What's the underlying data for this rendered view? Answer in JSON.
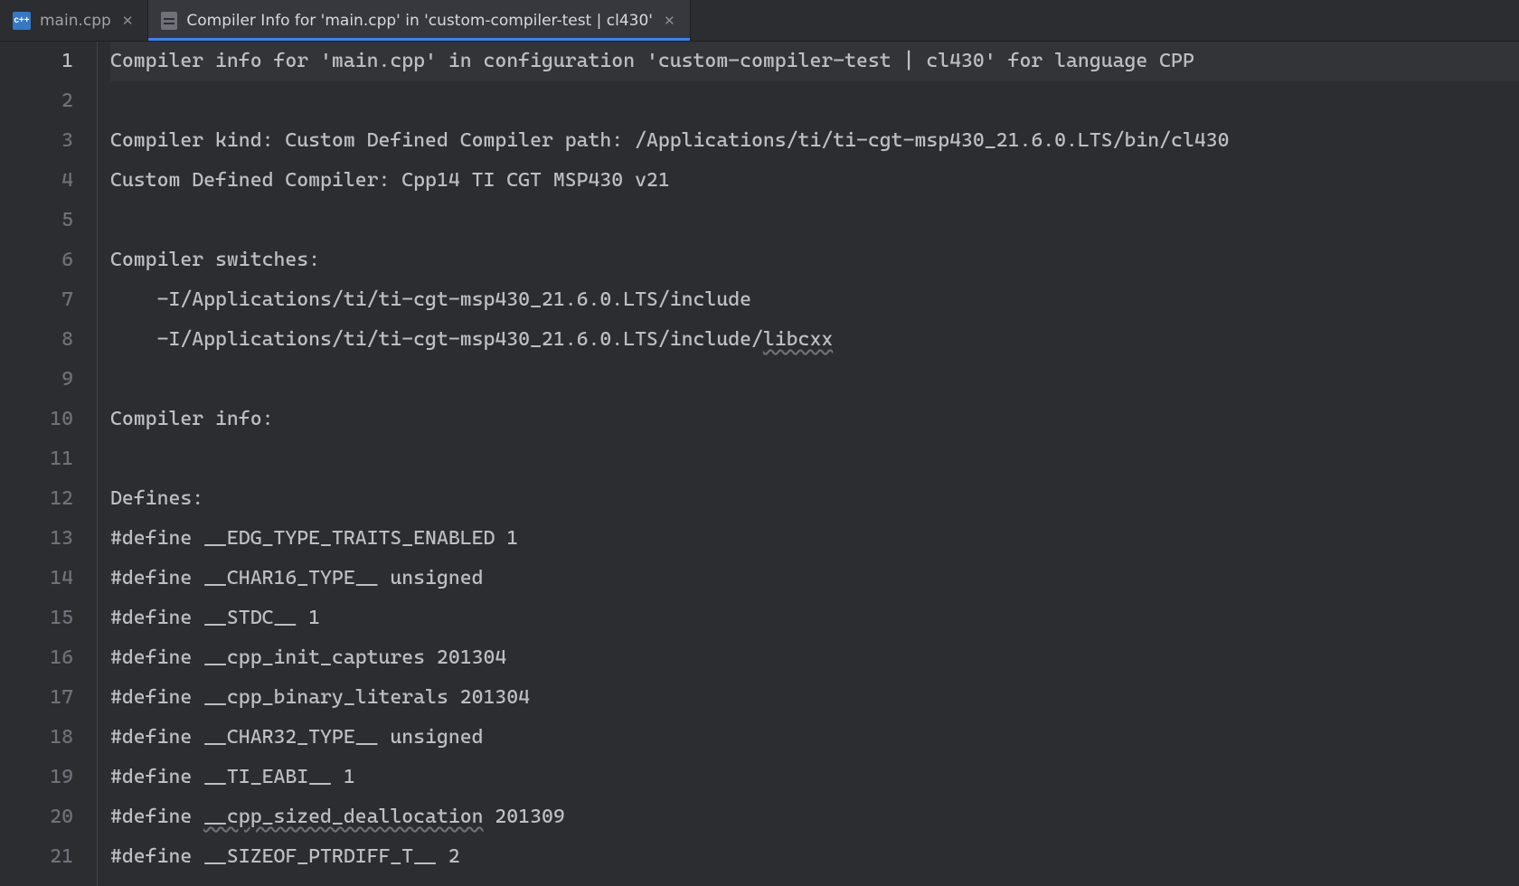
{
  "tabs": [
    {
      "label": "main.cpp",
      "icon": "cpp",
      "active": false
    },
    {
      "label": "Compiler Info for 'main.cpp' in 'custom-compiler-test | cl430'",
      "icon": "doc",
      "active": true
    }
  ],
  "editor": {
    "current_line": 1,
    "lines": [
      {
        "n": 1,
        "text": "Compiler info for 'main.cpp' in configuration 'custom-compiler-test | cl430' for language CPP"
      },
      {
        "n": 2,
        "text": ""
      },
      {
        "n": 3,
        "text": "Compiler kind: Custom Defined Compiler path: /Applications/ti/ti-cgt-msp430_21.6.0.LTS/bin/cl430"
      },
      {
        "n": 4,
        "text": "Custom Defined Compiler: Cpp14 TI CGT MSP430 v21"
      },
      {
        "n": 5,
        "text": ""
      },
      {
        "n": 6,
        "text": "Compiler switches:"
      },
      {
        "n": 7,
        "text": "    -I/Applications/ti/ti-cgt-msp430_21.6.0.LTS/include"
      },
      {
        "n": 8,
        "segments": [
          {
            "text": "    -I/Applications/ti/ti-cgt-msp430_21.6.0.LTS/include/"
          },
          {
            "text": "libcxx",
            "wavy": true
          }
        ]
      },
      {
        "n": 9,
        "text": ""
      },
      {
        "n": 10,
        "text": "Compiler info:"
      },
      {
        "n": 11,
        "text": ""
      },
      {
        "n": 12,
        "text": "Defines:"
      },
      {
        "n": 13,
        "text": "#define __EDG_TYPE_TRAITS_ENABLED 1"
      },
      {
        "n": 14,
        "text": "#define __CHAR16_TYPE__ unsigned"
      },
      {
        "n": 15,
        "text": "#define __STDC__ 1"
      },
      {
        "n": 16,
        "text": "#define __cpp_init_captures 201304"
      },
      {
        "n": 17,
        "text": "#define __cpp_binary_literals 201304"
      },
      {
        "n": 18,
        "text": "#define __CHAR32_TYPE__ unsigned"
      },
      {
        "n": 19,
        "text": "#define __TI_EABI__ 1"
      },
      {
        "n": 20,
        "segments": [
          {
            "text": "#define "
          },
          {
            "text": "__cpp_sized_deallocation",
            "wavy": true
          },
          {
            "text": " 201309"
          }
        ]
      },
      {
        "n": 21,
        "text": "#define __SIZEOF_PTRDIFF_T__ 2"
      }
    ]
  }
}
